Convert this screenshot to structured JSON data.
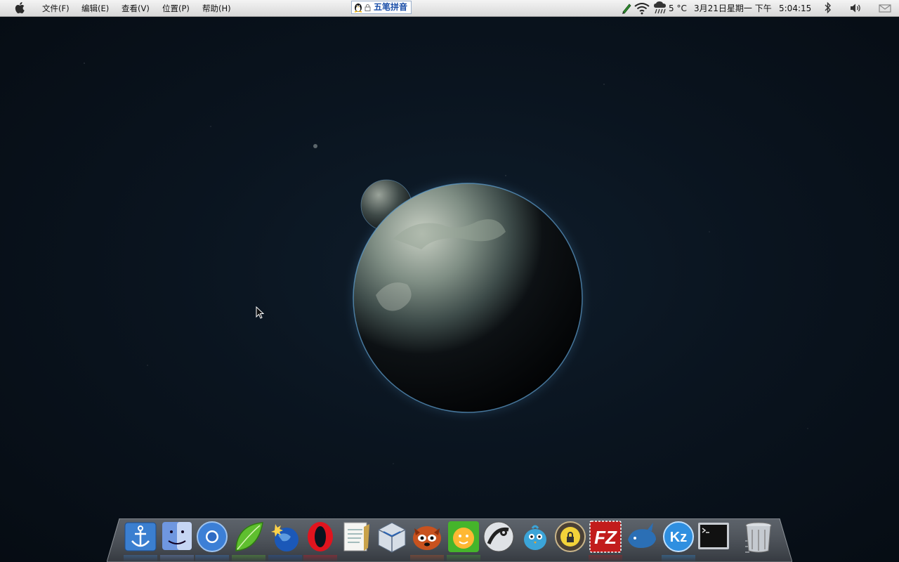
{
  "menubar": {
    "apple_icon": "apple-logo-icon",
    "menus": [
      {
        "label": "文件(F)"
      },
      {
        "label": "编辑(E)"
      },
      {
        "label": "查看(V)"
      },
      {
        "label": "位置(P)"
      },
      {
        "label": "帮助(H)"
      }
    ],
    "input_method": {
      "label": "五笔拼音",
      "icons": [
        "penguin-icon",
        "lock-icon"
      ]
    },
    "tray": {
      "icons": [
        "pen-icon",
        "wifi-icon",
        "rain-weather-icon",
        "bluetooth-icon",
        "volume-icon",
        "mail-icon"
      ],
      "temperature": "5 °C",
      "date": "3月21日星期一 下午",
      "time": "5:04:15"
    }
  },
  "dock": {
    "items": [
      {
        "icon": "anchor-icon"
      },
      {
        "icon": "finder-icon"
      },
      {
        "icon": "chromium-icon"
      },
      {
        "icon": "leaf-icon"
      },
      {
        "icon": "globe-icon"
      },
      {
        "icon": "opera-icon"
      },
      {
        "icon": "text-editor-icon"
      },
      {
        "icon": "virtualbox-icon"
      },
      {
        "icon": "red-panda-icon"
      },
      {
        "icon": "qq-icon"
      },
      {
        "icon": "steam-icon"
      },
      {
        "icon": "blue-bird-icon"
      },
      {
        "icon": "lock-face-icon"
      },
      {
        "icon": "filezilla-icon"
      },
      {
        "icon": "dolphin-icon"
      },
      {
        "icon": "kz-icon"
      },
      {
        "icon": "terminal-icon"
      },
      {
        "icon": "trash-icon"
      }
    ],
    "kz_label": "Kz",
    "filezilla_label": "FZ",
    "opera_label": "O"
  },
  "colors": {
    "menubar_top": "#f4f4f4",
    "menubar_bottom": "#d8d8d8",
    "desktop": "#0a141f",
    "ime_text": "#1a4ea8"
  }
}
